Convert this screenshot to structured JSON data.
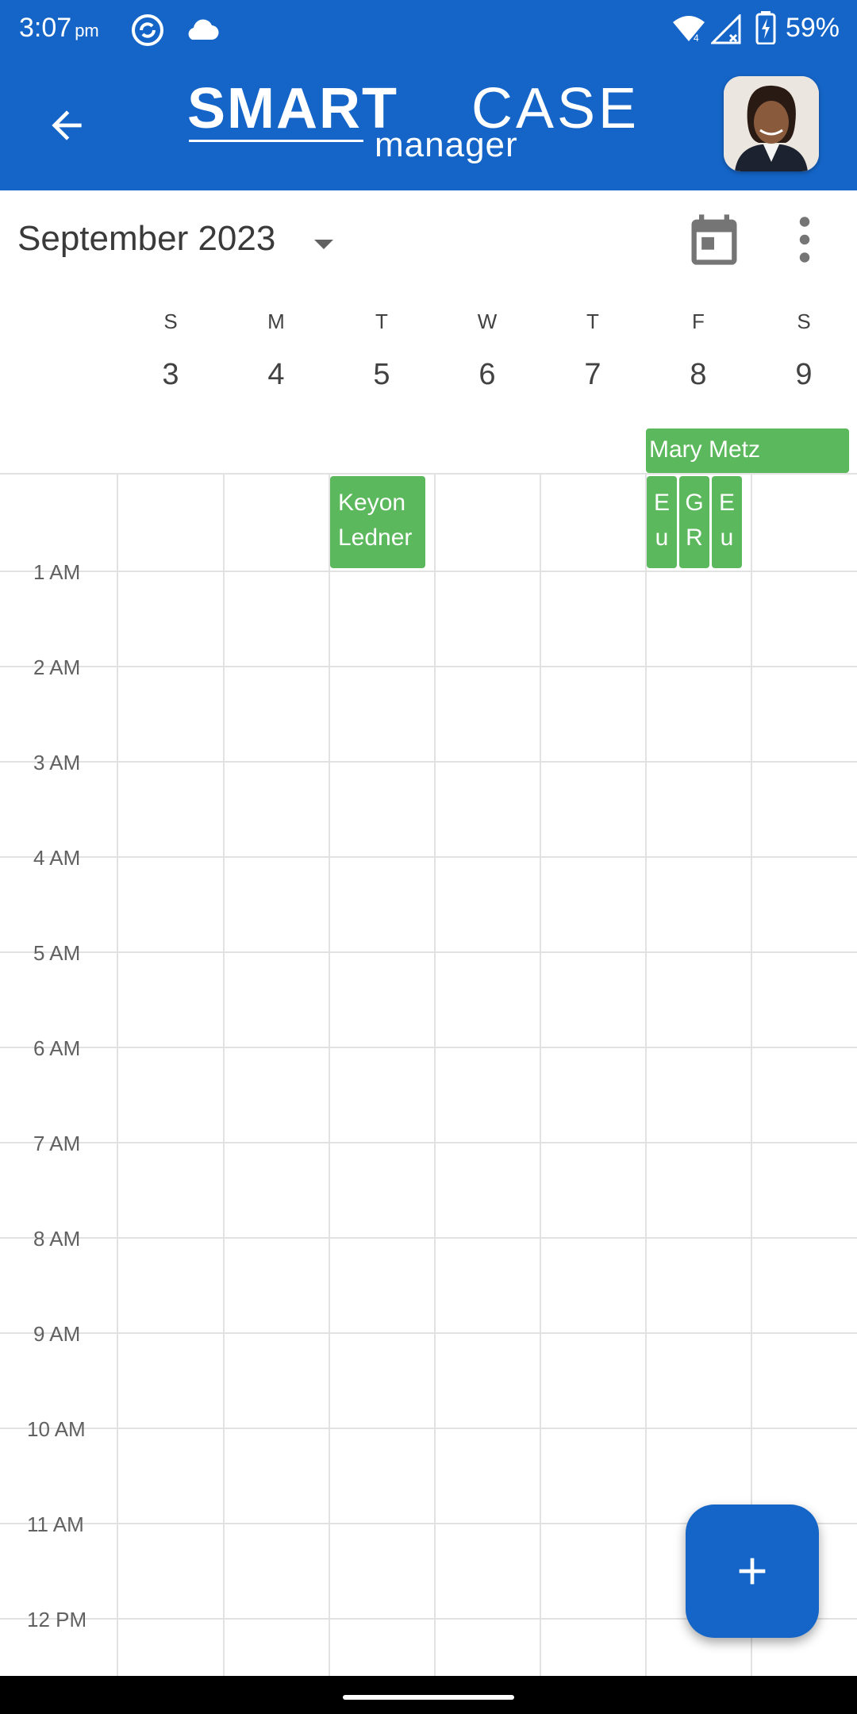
{
  "status_bar": {
    "time": "3:07",
    "ampm": "pm",
    "battery": "59%"
  },
  "app_bar": {
    "logo_smart": "SMART",
    "logo_case": "CASE",
    "logo_manager": "manager"
  },
  "calendar": {
    "month_label": "September 2023",
    "days": [
      {
        "dow": "S",
        "num": "3"
      },
      {
        "dow": "M",
        "num": "4"
      },
      {
        "dow": "T",
        "num": "5"
      },
      {
        "dow": "W",
        "num": "6"
      },
      {
        "dow": "T",
        "num": "7"
      },
      {
        "dow": "F",
        "num": "8"
      },
      {
        "dow": "S",
        "num": "9"
      }
    ],
    "hours": [
      "1 AM",
      "2 AM",
      "3 AM",
      "4 AM",
      "5 AM",
      "6 AM",
      "7 AM",
      "8 AM",
      "9 AM",
      "10 AM",
      "11 AM",
      "12 PM"
    ],
    "all_day_event": "Mary Metz",
    "events": {
      "keyon_line1": "Keyon",
      "keyon_line2": "Ledner",
      "fri_a_line1": "E",
      "fri_a_line2": "u",
      "fri_b_line1": "G",
      "fri_b_line2": "R",
      "fri_c_line1": "E",
      "fri_c_line2": "u"
    }
  },
  "colors": {
    "brand_blue": "#1565C8",
    "event_green": "#5CB85C"
  },
  "icons": {
    "back": "arrow-left-icon",
    "calendar": "calendar-today-icon",
    "more": "more-vert-icon",
    "fab": "plus-icon"
  }
}
